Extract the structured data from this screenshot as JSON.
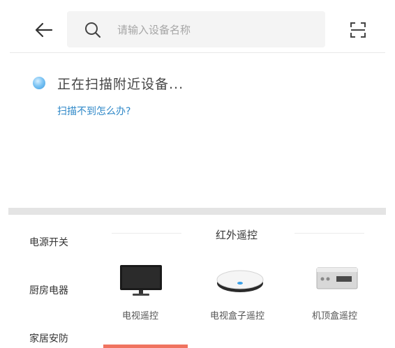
{
  "search": {
    "placeholder": "请输入设备名称"
  },
  "scan": {
    "status": "正在扫描附近设备...",
    "help_link": "扫描不到怎么办?"
  },
  "categories": [
    {
      "label": "电源开关"
    },
    {
      "label": "厨房电器"
    },
    {
      "label": "家居安防"
    }
  ],
  "panel": {
    "title": "红外遥控",
    "devices": [
      {
        "label": "电视遥控",
        "icon": "tv-icon"
      },
      {
        "label": "电视盒子遥控",
        "icon": "tv-box-icon"
      },
      {
        "label": "机顶盒遥控",
        "icon": "set-top-box-icon"
      }
    ]
  },
  "colors": {
    "link": "#2f88c8",
    "accent": "#f0735f",
    "divider": "#e4e4e4"
  }
}
